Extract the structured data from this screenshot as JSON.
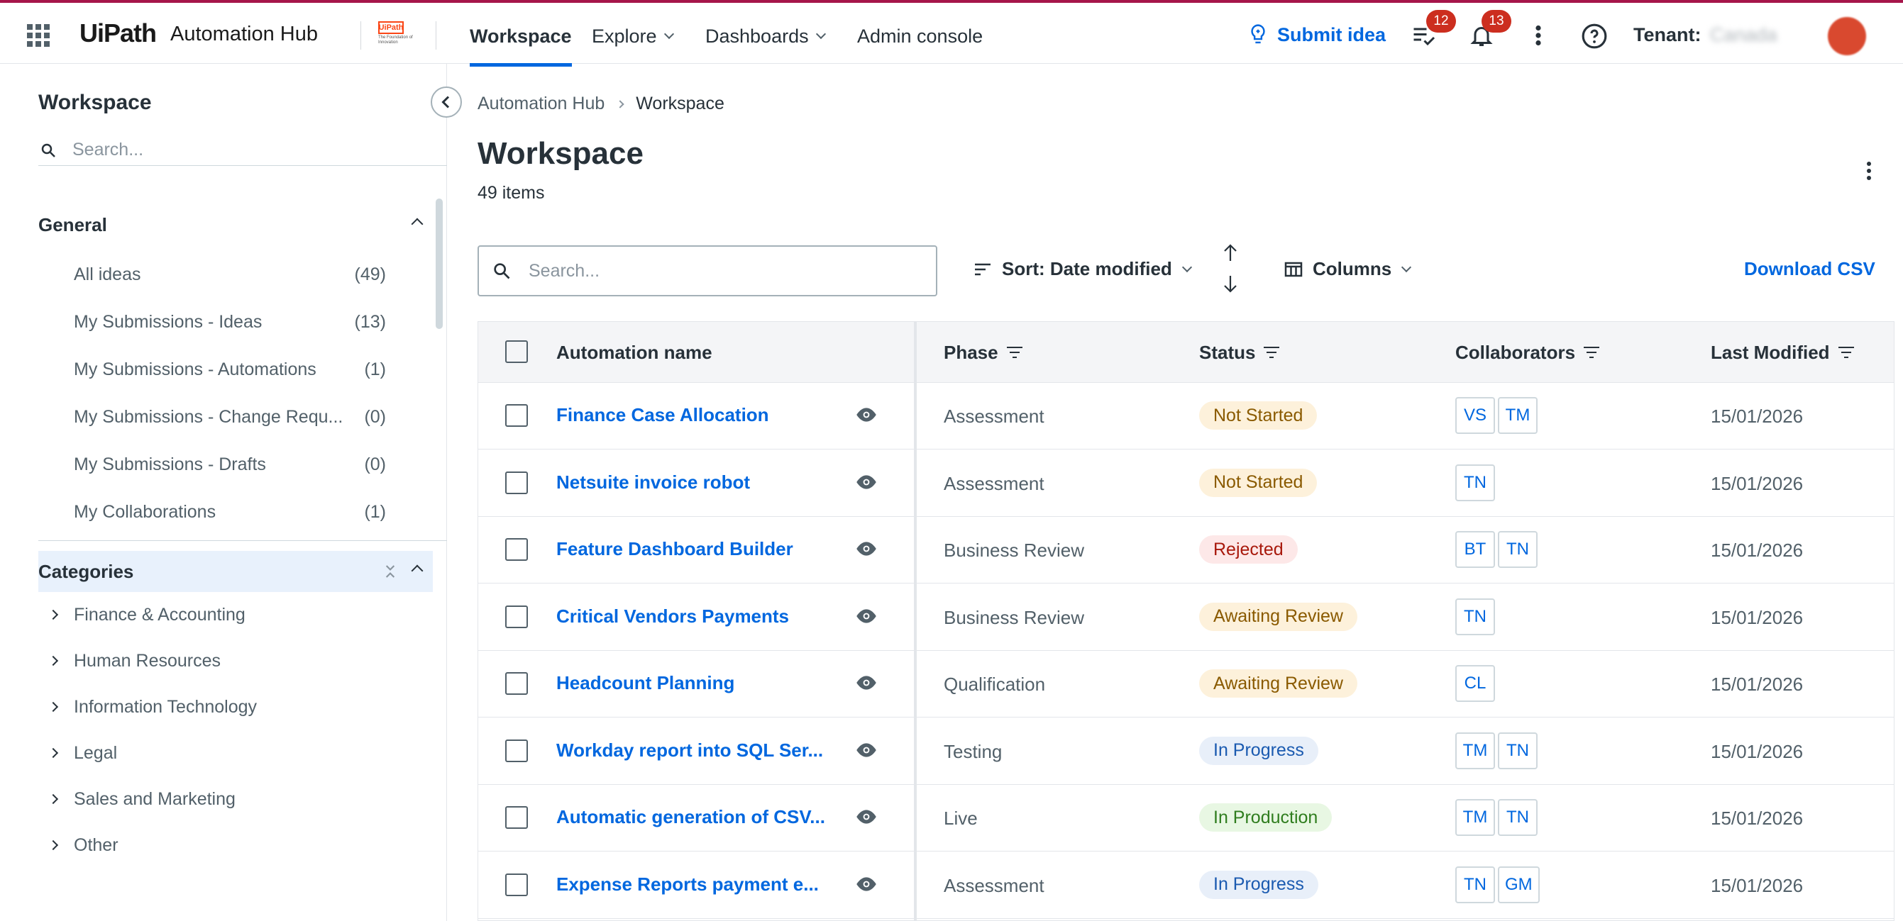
{
  "header": {
    "logo_ui": "Ui",
    "logo_path": "Path",
    "product": "Automation Hub",
    "sublogo_mark": "UiPath",
    "sublogo_tagline": "The Foundation of Innovation",
    "nav": [
      "Workspace",
      "Explore",
      "Dashboards",
      "Admin console"
    ],
    "submit_idea": "Submit idea",
    "tasks_badge": "12",
    "notifications_badge": "13",
    "tenant_label": "Tenant:",
    "tenant_value": "Canada"
  },
  "sidebar": {
    "title": "Workspace",
    "search_placeholder": "Search...",
    "general_label": "General",
    "general_items": [
      {
        "label": "All ideas",
        "count": "(49)"
      },
      {
        "label": "My Submissions - Ideas",
        "count": "(13)"
      },
      {
        "label": "My Submissions - Automations",
        "count": "(1)"
      },
      {
        "label": "My Submissions - Change Requ...",
        "count": "(0)"
      },
      {
        "label": "My Submissions - Drafts",
        "count": "(0)"
      },
      {
        "label": "My Collaborations",
        "count": "(1)"
      }
    ],
    "categories_label": "Categories",
    "categories": [
      "Finance & Accounting",
      "Human Resources",
      "Information Technology",
      "Legal",
      "Sales and Marketing",
      "Other"
    ]
  },
  "main": {
    "breadcrumb_root": "Automation Hub",
    "breadcrumb_current": "Workspace",
    "title": "Workspace",
    "item_count": "49 items",
    "search_placeholder": "Search...",
    "sort_label": "Sort: Date modified",
    "columns_label": "Columns",
    "download_csv": "Download CSV"
  },
  "table": {
    "headers": [
      "Automation name",
      "Phase",
      "Status",
      "Collaborators",
      "Last Modified"
    ],
    "status_colors": {
      "Not Started": {
        "bg": "#fdf1db",
        "fg": "#8a5a00"
      },
      "Rejected": {
        "bg": "#fde8e8",
        "fg": "#a8190c"
      },
      "Awaiting Review": {
        "bg": "#fdf1db",
        "fg": "#8a5a00"
      },
      "In Progress": {
        "bg": "#e8eff9",
        "fg": "#1a5ab0"
      },
      "In Production": {
        "bg": "#e8f7e3",
        "fg": "#2f7d1e"
      }
    },
    "rows": [
      {
        "name": "Finance Case Allocation",
        "phase": "Assessment",
        "status": "Not Started",
        "collaborators": [
          "VS",
          "TM"
        ],
        "modified": "15/01/2026"
      },
      {
        "name": "Netsuite invoice robot",
        "phase": "Assessment",
        "status": "Not Started",
        "collaborators": [
          "TN"
        ],
        "modified": "15/01/2026"
      },
      {
        "name": "Feature Dashboard Builder",
        "phase": "Business Review",
        "status": "Rejected",
        "collaborators": [
          "BT",
          "TN"
        ],
        "modified": "15/01/2026"
      },
      {
        "name": "Critical Vendors Payments",
        "phase": "Business Review",
        "status": "Awaiting Review",
        "collaborators": [
          "TN"
        ],
        "modified": "15/01/2026"
      },
      {
        "name": "Headcount Planning",
        "phase": "Qualification",
        "status": "Awaiting Review",
        "collaborators": [
          "CL"
        ],
        "modified": "15/01/2026"
      },
      {
        "name": "Workday report into SQL Ser...",
        "phase": "Testing",
        "status": "In Progress",
        "collaborators": [
          "TM",
          "TN"
        ],
        "modified": "15/01/2026"
      },
      {
        "name": "Automatic generation of CSV...",
        "phase": "Live",
        "status": "In Production",
        "collaborators": [
          "TM",
          "TN"
        ],
        "modified": "15/01/2026"
      },
      {
        "name": "Expense Reports payment e...",
        "phase": "Assessment",
        "status": "In Progress",
        "collaborators": [
          "TN",
          "GM"
        ],
        "modified": "15/01/2026"
      }
    ]
  }
}
